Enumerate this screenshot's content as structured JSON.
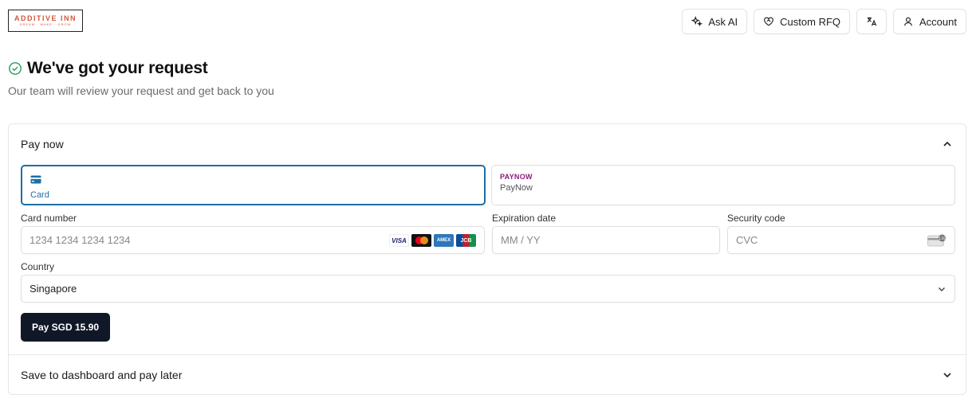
{
  "brand": {
    "logo_main": "ADDITIVE INN",
    "logo_sub": "DREAM · MAKE · GROW"
  },
  "header": {
    "ask_ai_label": "Ask AI",
    "custom_rfq_label": "Custom RFQ",
    "account_label": "Account",
    "icons": [
      "sparkles-icon",
      "heart-handshake-icon",
      "translate-icon",
      "user-icon"
    ]
  },
  "confirmation": {
    "title": "We've got your request",
    "subtitle": "Our team will review your request and get back to you"
  },
  "payment": {
    "section_title": "Pay now",
    "methods": [
      {
        "label": "Card",
        "selected": true
      },
      {
        "label": "PayNow",
        "logo": "PAYNOW",
        "selected": false
      }
    ],
    "card_number": {
      "label": "Card number",
      "placeholder": "1234 1234 1234 1234",
      "brands": [
        "VISA",
        "Mastercard",
        "AMEX",
        "JCB"
      ]
    },
    "expiration": {
      "label": "Expiration date",
      "placeholder": "MM / YY"
    },
    "security": {
      "label": "Security code",
      "placeholder": "CVC"
    },
    "country": {
      "label": "Country",
      "value": "Singapore"
    },
    "pay_button_label": "Pay SGD 15.90"
  },
  "later": {
    "section_title": "Save to dashboard and pay later"
  },
  "colors": {
    "accent": "#1d6fa5",
    "button_dark": "#101828",
    "success": "#2e9a5a",
    "paynow": "#8a1c7c"
  }
}
